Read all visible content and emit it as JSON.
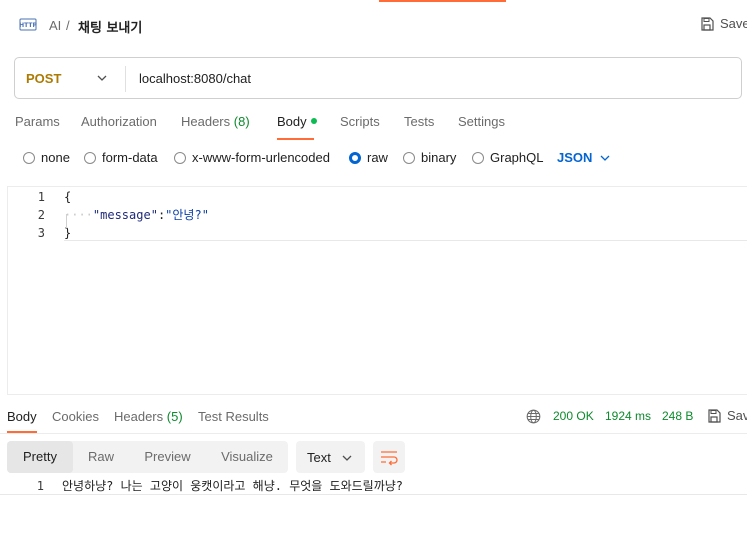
{
  "header": {
    "breadcrumb_parent": "AI",
    "breadcrumb_sep": "/",
    "breadcrumb_current": "채팅 보내기",
    "save_label": "Save"
  },
  "request": {
    "method": "POST",
    "url": "localhost:8080/chat"
  },
  "request_tabs": [
    {
      "label": "Params"
    },
    {
      "label": "Authorization"
    },
    {
      "label": "Headers",
      "count": "(8)"
    },
    {
      "label": "Body"
    },
    {
      "label": "Scripts"
    },
    {
      "label": "Tests"
    },
    {
      "label": "Settings"
    }
  ],
  "body_types": [
    {
      "label": "none",
      "selected": false
    },
    {
      "label": "form-data",
      "selected": false
    },
    {
      "label": "x-www-form-urlencoded",
      "selected": false
    },
    {
      "label": "raw",
      "selected": true
    },
    {
      "label": "binary",
      "selected": false
    },
    {
      "label": "GraphQL",
      "selected": false
    }
  ],
  "raw_format": "JSON",
  "editor": {
    "lines": [
      {
        "n": "1",
        "text": "{"
      },
      {
        "n": "2",
        "key": "\"message\"",
        "colon": ":",
        "value": "\"안녕?\""
      },
      {
        "n": "3",
        "text": "}"
      }
    ]
  },
  "response_tabs": [
    {
      "label": "Body"
    },
    {
      "label": "Cookies"
    },
    {
      "label": "Headers",
      "count": "(5)"
    },
    {
      "label": "Test Results"
    }
  ],
  "response_meta": {
    "status": "200 OK",
    "time": "1924 ms",
    "size": "248 B",
    "save_label": "Save"
  },
  "response_view": {
    "modes": [
      "Pretty",
      "Raw",
      "Preview",
      "Visualize"
    ],
    "format": "Text"
  },
  "response_body": {
    "n": "1",
    "text": "안녕하냥? 나는 고양이 웅캣이라고 해냥. 무엇을 도와드릴까냥?"
  },
  "colors": {
    "accent": "#ff6c37",
    "method": "#ad7a03",
    "status_ok": "#0d8a2d",
    "link_blue": "#0265d2"
  }
}
